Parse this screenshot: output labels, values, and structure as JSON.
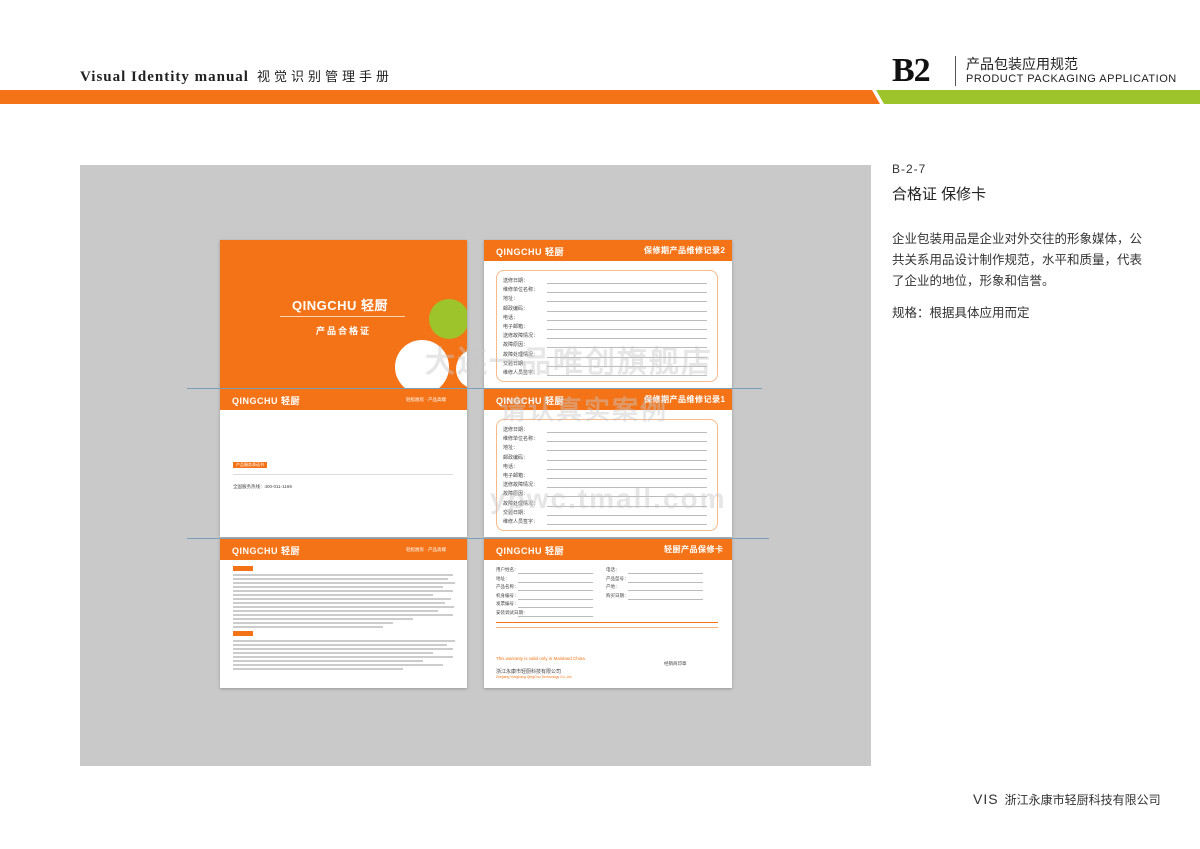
{
  "header": {
    "title_en": "Visual Identity  manual",
    "title_cn": "视觉识别管理手册",
    "section_code": "B2",
    "section_cn": "产品包装应用规范",
    "section_en": "PRODUCT PACKAGING APPLICATION",
    "bar_colors": {
      "orange": "#f47316",
      "green": "#9dc42b"
    }
  },
  "cards": {
    "brand_logo": "QINGCHU 轻厨",
    "cover_title": "产品合格证",
    "slogan": "轻松厨房 · 产品高端",
    "record2_title": "保修期产品维修记录2",
    "record1_title": "保修期产品维修记录1",
    "warranty_title": "轻厨产品保修卡",
    "form_fields": [
      "送修日期：",
      "维修单位名称：",
      "地址：",
      "邮政编码：",
      "电话：",
      "电子邮箱：",
      "送修故障情况：",
      "故障原因：",
      "故障处理情况：",
      "交验日期：",
      "维修人员签字："
    ],
    "company": "浙江永康市轻厨科技有限公司",
    "company_en": "Zhejiang Yongkang QingChu Technology Co.,Ltd",
    "service_tag": "产品服务承诺书",
    "hotline": "全国服务热线：400-011-1169",
    "warranty_note": "This warranty is valid only in Mainland China",
    "stamp_label": "经销商印章",
    "warranty_fields_left": [
      "用户姓名：",
      "地址：",
      "产品名称：",
      "机身编号：",
      "发票编号：",
      "安装调试日期："
    ],
    "warranty_fields_right": [
      "电话：",
      "产品型号：",
      "产地：",
      "购买日期："
    ]
  },
  "watermark": {
    "line1": "大连一品唯创旗舰店",
    "line2": "请认真实案例",
    "line3": "ypwc.tmall.com"
  },
  "side": {
    "code": "B-2-7",
    "title": "合格证 保修卡",
    "description": "企业包装用品是企业对外交往的形象媒体，公共关系用品设计制作规范，水平和质量，代表了企业的地位，形象和信誉。",
    "spec": "规格：根据具体应用而定"
  },
  "footer": {
    "vis": "VIS",
    "company": "浙江永康市轻厨科技有限公司"
  }
}
